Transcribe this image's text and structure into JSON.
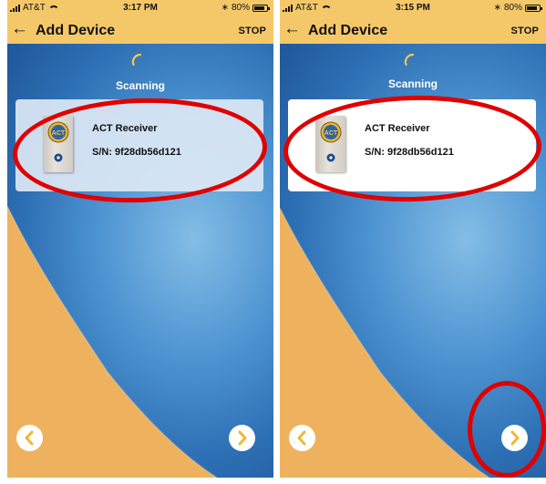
{
  "screens": [
    {
      "status": {
        "carrier": "AT&T",
        "time": "3:17 PM",
        "battery": "80%"
      },
      "nav": {
        "title": "Add Device",
        "stop_label": "STOP"
      },
      "scan_label": "Scanning",
      "device": {
        "name": "ACT Receiver",
        "serial": "S/N: 9f28db56d121"
      }
    },
    {
      "status": {
        "carrier": "AT&T",
        "time": "3:15 PM",
        "battery": "80%"
      },
      "nav": {
        "title": "Add Device",
        "stop_label": "STOP"
      },
      "scan_label": "Scanning",
      "device": {
        "name": "ACT Receiver",
        "serial": "S/N: 9f28db56d121"
      }
    }
  ],
  "icons": {
    "back": "left-arrow",
    "spinner": "loading-arc",
    "prev": "chevron-left",
    "next": "chevron-right",
    "status": [
      "signal-bars",
      "wifi",
      "bluetooth",
      "battery"
    ]
  },
  "colors": {
    "header": "#f4c869",
    "accent": "#f0b735",
    "highlight": "#e00000",
    "background_blue": "#2d6fb4"
  }
}
